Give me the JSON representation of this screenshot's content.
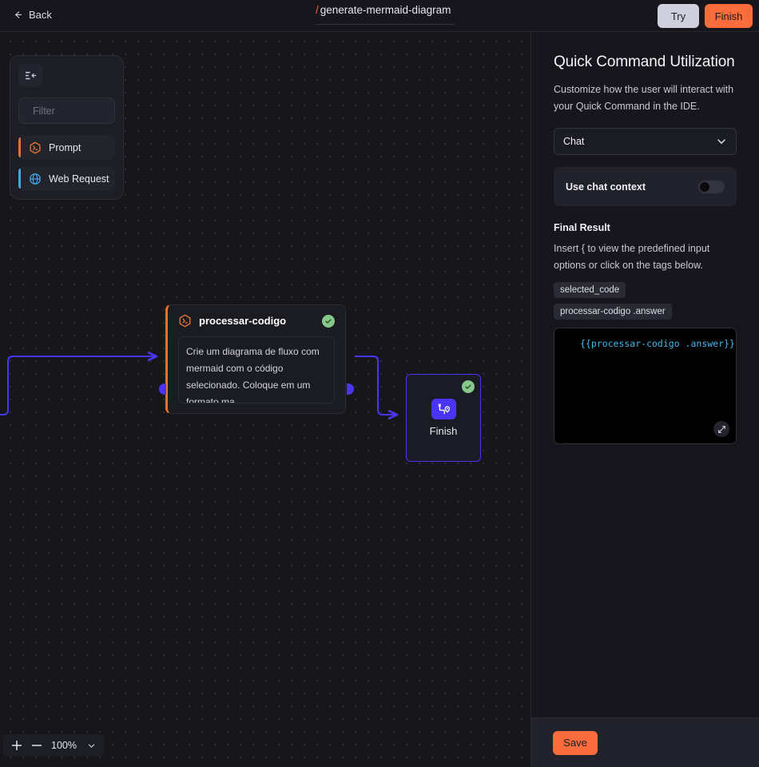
{
  "topbar": {
    "back_label": "Back",
    "back_icon": "arrow-left-icon",
    "doc_slash": "/",
    "doc_title": "generate-mermaid-diagram",
    "try_label": "Try",
    "finish_label": "Finish"
  },
  "palette": {
    "collapse_icon": "panel-collapse-left-icon",
    "filter_placeholder": "Filter",
    "filter_value": "",
    "search_icon": "search-icon",
    "items": [
      {
        "label": "Prompt",
        "icon": "hexagon-terminal-icon",
        "accent": "#e2722e",
        "icon_color": "#e2722e"
      },
      {
        "label": "Web Request",
        "icon": "globe-icon",
        "accent": "#3da9e8",
        "icon_color": "#3da9e8"
      }
    ]
  },
  "canvas": {
    "edge_color": "#4b35f5",
    "nodes": {
      "prompt": {
        "title": "processar-codigo",
        "icon": "hexagon-terminal-icon",
        "status_icon": "check-circle-icon",
        "accent": "#e2722e",
        "body_text": "Crie um diagrama de fluxo com mermaid com o código selecionado. Coloque em um formato ma…"
      },
      "finish": {
        "label": "Finish",
        "icon": "route-pin-icon",
        "status_icon": "check-circle-icon",
        "accent": "#4b35f5"
      }
    },
    "zoom": {
      "zoom_in_icon": "plus-icon",
      "zoom_out_icon": "minus-icon",
      "level": "100%",
      "chevron_icon": "chevron-down-icon"
    }
  },
  "panel": {
    "title": "Quick Command Utilization",
    "description": "Customize how the user will interact with your Quick Command in the IDE.",
    "mode_select": {
      "value": "Chat",
      "chevron_icon": "chevron-down-icon",
      "options": [
        "Chat"
      ]
    },
    "chat_context": {
      "label": "Use chat context",
      "enabled": false
    },
    "final_result": {
      "section_label": "Final Result",
      "hint": "Insert { to view the predefined input options or click on the tags below.",
      "tags": [
        "selected_code",
        "processar-codigo .answer"
      ],
      "code": "{{processar-codigo .answer}}",
      "code_color": "#3fb7ef",
      "expand_icon": "expand-diagonal-icon"
    },
    "save_label": "Save"
  }
}
